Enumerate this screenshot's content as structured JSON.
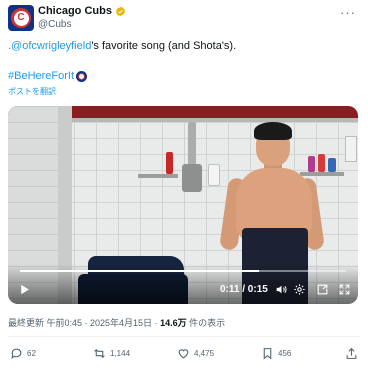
{
  "author": {
    "display_name": "Chicago Cubs",
    "handle": "@Cubs",
    "avatar_letter": "C",
    "verified_color": "#e8b400"
  },
  "tweet": {
    "mention": ".@ofcwrigleyfield",
    "text_rest": "'s favorite song (and Shota's).",
    "hashtag": "#BeHereForIt",
    "translate_label": "ポストを翻訳"
  },
  "video": {
    "time": "0:11 / 0:15",
    "progress_fraction": 0.733
  },
  "meta": {
    "prefix": "最終更新 午前0:45 · 2025年4月15日 · ",
    "views": "14.6万",
    "suffix": " 件の表示"
  },
  "actions": {
    "replies": "62",
    "reposts": "1,144",
    "likes": "4,475",
    "bookmarks": "456"
  },
  "colors": {
    "link": "#1d9bf0",
    "cubs_blue": "#0e3386",
    "cubs_red": "#cc3433"
  }
}
